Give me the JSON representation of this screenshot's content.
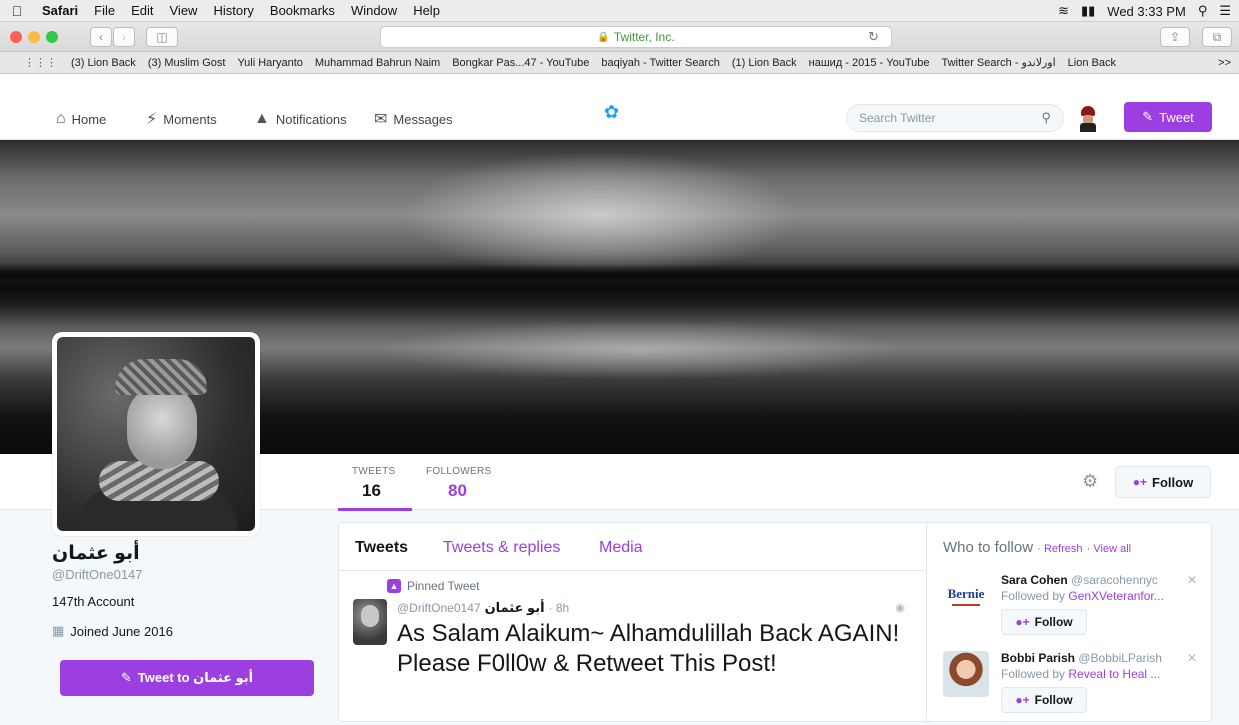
{
  "menubar": {
    "app": "Safari",
    "items": [
      "File",
      "Edit",
      "View",
      "History",
      "Bookmarks",
      "Window",
      "Help"
    ],
    "clock": "Wed 3:33 PM"
  },
  "browser": {
    "url_display": "Twitter, Inc.",
    "bookmarks": [
      "(3) Lion Back",
      "(3) Muslim Gost",
      "Yuli Haryanto",
      "Muhammad Bahrun Naim",
      "Bongkar Pas...47 - YouTube",
      "baqiyah - Twitter Search",
      "(1) Lion Back",
      "нашид - 2015 - YouTube",
      "Twitter Search - اورلاندو",
      "Lion Back"
    ],
    "more": ">>"
  },
  "twitter_nav": {
    "home": "Home",
    "moments": "Moments",
    "notifications": "Notifications",
    "messages": "Messages",
    "search_placeholder": "Search Twitter",
    "tweet_button": "Tweet"
  },
  "profile": {
    "name": "أبو عثمان",
    "handle": "@DriftOne0147",
    "bio": "147th Account",
    "joined": "Joined June 2016",
    "tweet_to": "Tweet to أبو عثمان"
  },
  "stats": {
    "tweets_label": "TWEETS",
    "tweets_value": "16",
    "followers_label": "FOLLOWERS",
    "followers_value": "80",
    "follow_label": "Follow"
  },
  "timeline": {
    "tabs": [
      "Tweets",
      "Tweets & replies",
      "Media"
    ],
    "pinned_label": "Pinned Tweet",
    "tweet_name": "أبو عثمان",
    "tweet_handle": "@DriftOne0147",
    "tweet_time": "· 8h",
    "tweet_text": "As Salam Alaikum~ Alhamdulillah Back AGAIN! Please F0ll0w & Retweet This Post!"
  },
  "who_to_follow": {
    "title": "Who to follow",
    "refresh": "Refresh",
    "view_all": "View all",
    "suggestions": [
      {
        "name": "Sara Cohen",
        "handle": "@saracohennyc",
        "followed_by_prefix": "Followed by",
        "followed_by": "GenXVeteranfor...",
        "follow": "Follow",
        "avatar_text": "Bernie"
      },
      {
        "name": "Bobbi Parish",
        "handle": "@BobbiLParish",
        "followed_by_prefix": "Followed by",
        "followed_by": "Reveal to Heal ...",
        "follow": "Follow"
      }
    ]
  },
  "colors": {
    "accent": "#9b3fe0",
    "twitter_blue": "#1da1f2"
  }
}
